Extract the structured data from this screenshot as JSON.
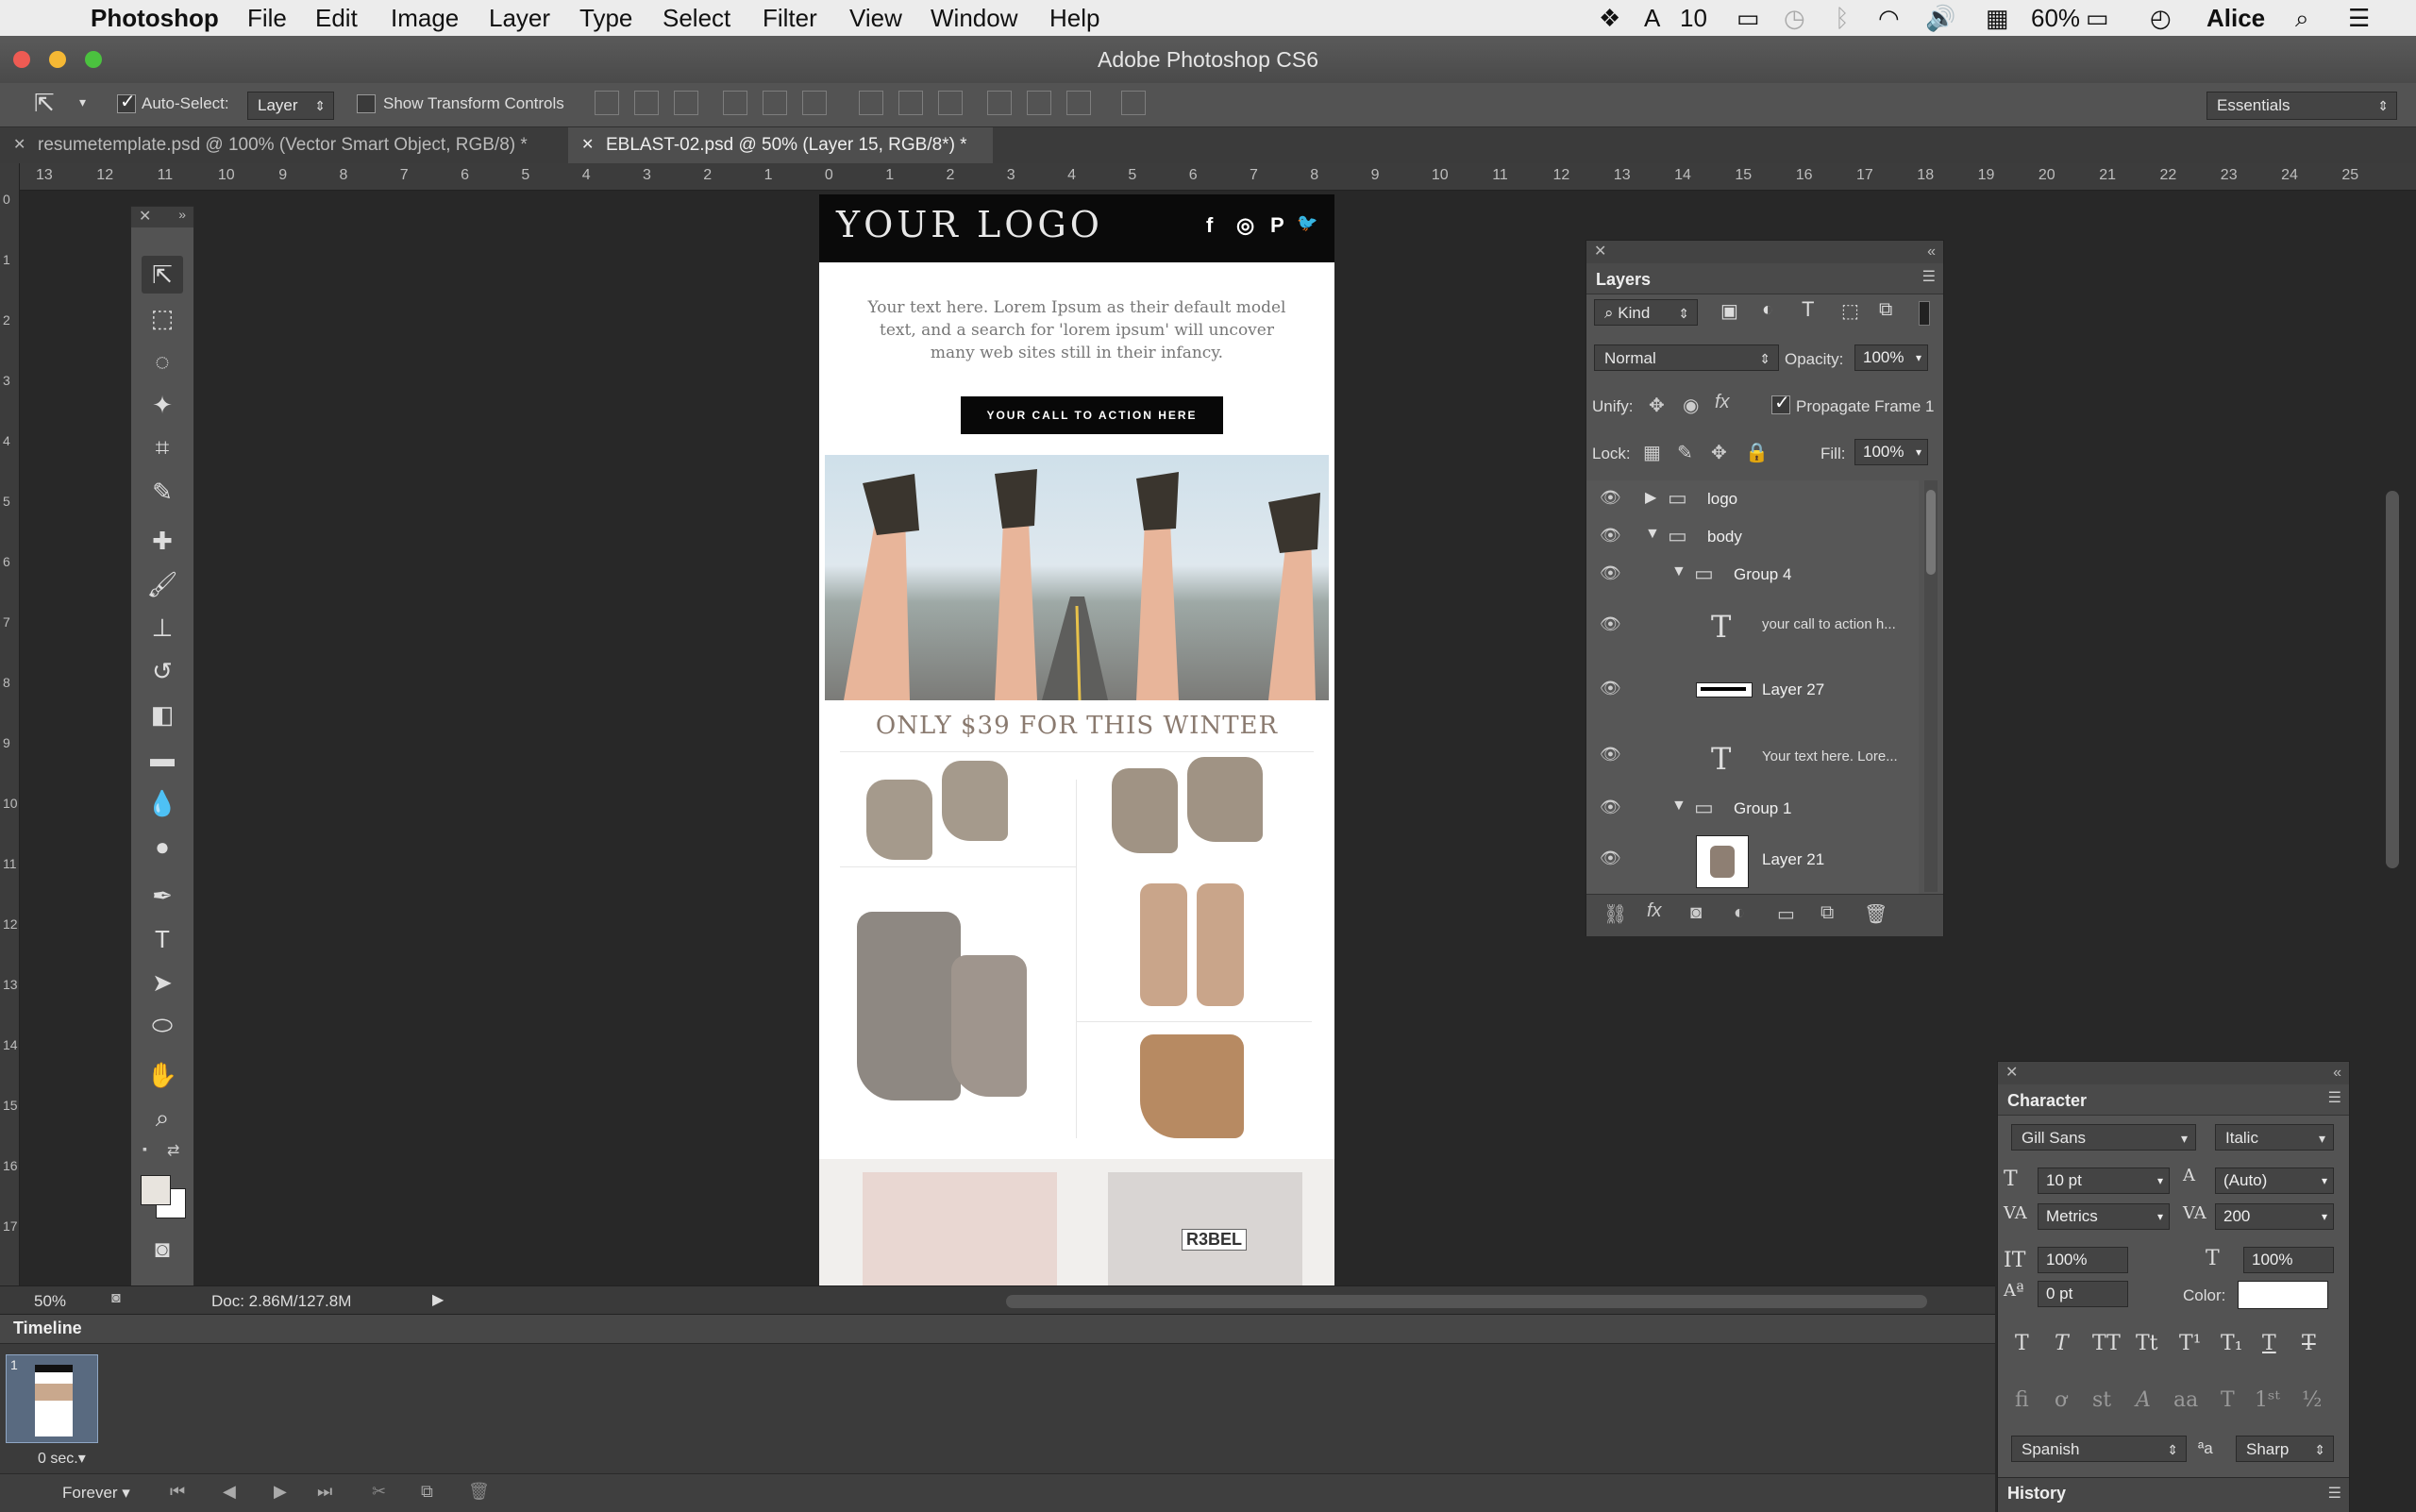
{
  "menubar": {
    "app": "Photoshop",
    "items": [
      "File",
      "Edit",
      "Image",
      "Layer",
      "Type",
      "Select",
      "Filter",
      "View",
      "Window",
      "Help"
    ],
    "status": {
      "adobe_count": "10",
      "battery": "60%",
      "user": "Alice"
    }
  },
  "window": {
    "title": "Adobe Photoshop CS6"
  },
  "options": {
    "auto_select_label": "Auto-Select:",
    "auto_select_value": "Layer",
    "show_transform_label": "Show Transform Controls",
    "workspace": "Essentials"
  },
  "tabs": [
    {
      "label": "resumetemplate.psd @ 100% (Vector Smart Object, RGB/8) *"
    },
    {
      "label": "EBLAST-02.psd @ 50% (Layer 15, RGB/8*) *"
    }
  ],
  "ruler": {
    "h": [
      "13",
      "12",
      "11",
      "10",
      "9",
      "8",
      "7",
      "6",
      "5",
      "4",
      "3",
      "2",
      "1",
      "0",
      "1",
      "2",
      "3",
      "4",
      "5",
      "6",
      "7",
      "8",
      "9",
      "10",
      "11",
      "12",
      "13",
      "14",
      "15",
      "16",
      "17",
      "18",
      "19",
      "20",
      "21",
      "22",
      "23",
      "24",
      "25"
    ],
    "v": [
      "0",
      "1",
      "2",
      "3",
      "4",
      "5",
      "6",
      "7",
      "8",
      "9",
      "10",
      "11",
      "12",
      "13",
      "14",
      "15",
      "16",
      "17"
    ]
  },
  "document": {
    "logo": "YOUR LOGO",
    "social": [
      "f",
      "◎",
      "P",
      "🐦"
    ],
    "intro": "Your text here. Lorem Ipsum as their default model text, and a search for 'lorem ipsum' will uncover many web sites still in their infancy.",
    "cta": "YOUR CALL TO ACTION HERE",
    "headline": "ONLY $39 FOR THIS WINTER",
    "shirt_text": "R3BEL"
  },
  "layers_panel": {
    "tab": "Layers",
    "filter": "Kind",
    "blend": "Normal",
    "opacity_label": "Opacity:",
    "opacity": "100%",
    "unify_label": "Unify:",
    "propagate": "Propagate Frame 1",
    "lock_label": "Lock:",
    "fill_label": "Fill:",
    "fill": "100%",
    "rows": [
      {
        "name": "logo"
      },
      {
        "name": "body"
      },
      {
        "name": "Group 4"
      },
      {
        "name": "your call to action h..."
      },
      {
        "name": "Layer 27"
      },
      {
        "name": "Your text here. Lore..."
      },
      {
        "name": "Group 1"
      },
      {
        "name": "Layer 21"
      }
    ]
  },
  "character_panel": {
    "tab": "Character",
    "font": "Gill Sans",
    "style": "Italic",
    "size": "10 pt",
    "leading": "(Auto)",
    "kerning": "Metrics",
    "tracking": "200",
    "vscale": "100%",
    "hscale": "100%",
    "baseline": "0 pt",
    "color_label": "Color:",
    "language": "Spanish",
    "aa_label": "a",
    "antialias": "Sharp"
  },
  "status": {
    "zoom": "50%",
    "doc": "Doc: 2.86M/127.8M"
  },
  "timeline": {
    "tab": "Timeline",
    "frame_number": "1",
    "frame_delay": "0 sec.",
    "loop": "Forever"
  },
  "history": {
    "tab": "History"
  }
}
